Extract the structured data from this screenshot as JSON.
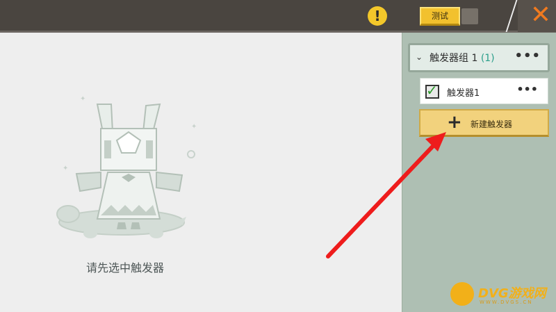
{
  "topbar": {
    "alert_icon": "exclamation-icon",
    "alert_glyph": "!",
    "test_label": "测试",
    "close_icon": "close-icon",
    "close_glyph": "✕",
    "accent_color": "#f2c12e",
    "close_color": "#f07a1f"
  },
  "main": {
    "empty_hint": "请先选中触发器",
    "illustration": "rabbit-on-turtle-illustration"
  },
  "panel": {
    "group": {
      "title": "触发器组 1",
      "count": "(1)",
      "more": "•••",
      "chevron": "⌄"
    },
    "triggers": [
      {
        "label": "触发器1",
        "checked": true,
        "more": "•••",
        "check_glyph": "✓"
      }
    ],
    "new_trigger": {
      "plus": "+",
      "label": "新建触发器"
    }
  },
  "watermark": {
    "text": "DVG游戏网",
    "sub": "WWW.DVGS.CN"
  }
}
